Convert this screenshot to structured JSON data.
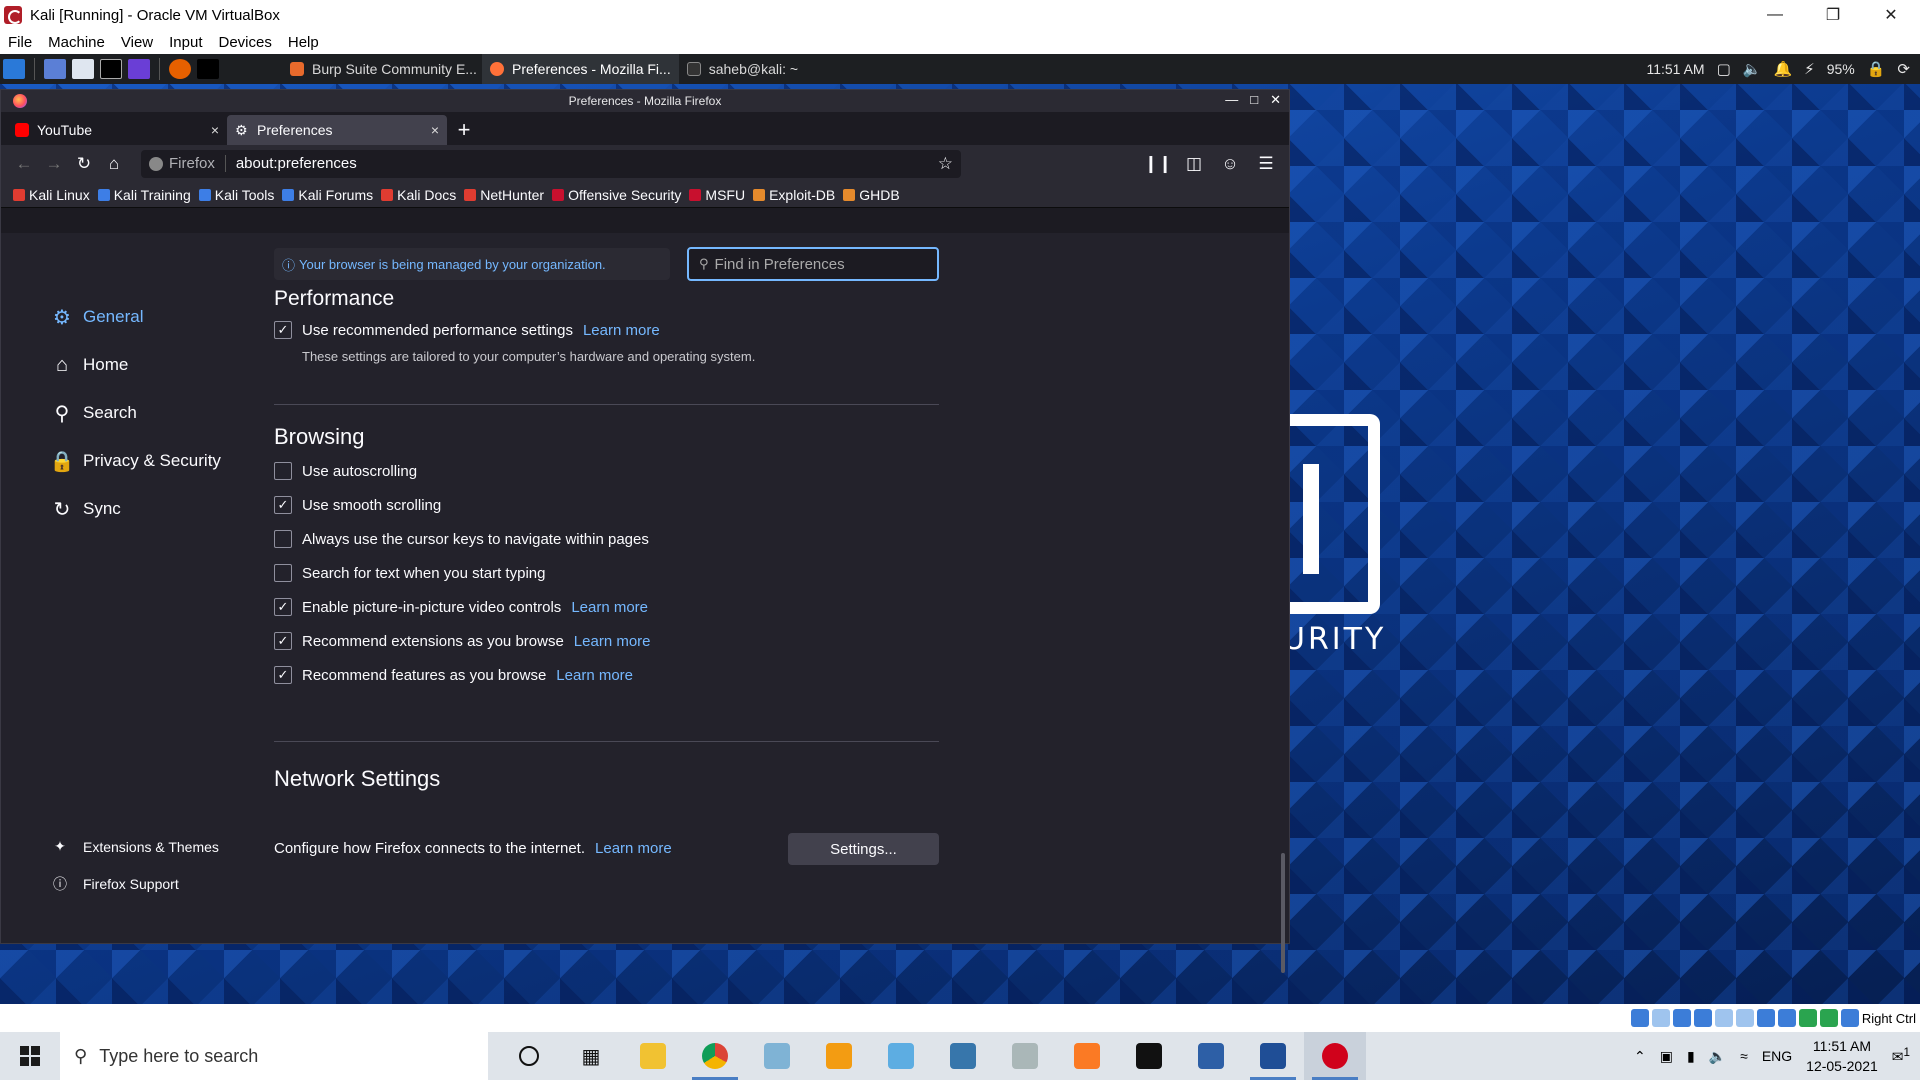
{
  "host": {
    "title": "Kali [Running] - Oracle VM VirtualBox",
    "menu": [
      "File",
      "Machine",
      "View",
      "Input",
      "Devices",
      "Help"
    ],
    "status_right_ctrl": "Right Ctrl"
  },
  "kali_panel": {
    "tasks": [
      "Burp Suite Community E...",
      "Preferences - Mozilla Fi...",
      "saheb@kali: ~"
    ],
    "time": "11:51 AM",
    "battery": "95%"
  },
  "wallpaper_text": "URITY",
  "firefox": {
    "window_title": "Preferences - Mozilla Firefox",
    "tabs": [
      {
        "label": "YouTube",
        "close": "×"
      },
      {
        "label": "Preferences",
        "close": "×"
      }
    ],
    "new_tab": "+",
    "url_identity": "Firefox",
    "url": "about:preferences",
    "bookmarks": [
      "Kali Linux",
      "Kali Training",
      "Kali Tools",
      "Kali Forums",
      "Kali Docs",
      "NetHunter",
      "Offensive Security",
      "MSFU",
      "Exploit-DB",
      "GHDB"
    ]
  },
  "prefs": {
    "policy_notice": "Your browser is being managed by your organization.",
    "find_placeholder": "Find in Preferences",
    "nav": [
      "General",
      "Home",
      "Search",
      "Privacy & Security",
      "Sync"
    ],
    "footer": [
      "Extensions & Themes",
      "Firefox Support"
    ],
    "performance": {
      "title": "Performance",
      "recommended": "Use recommended performance settings",
      "hint": "These settings are tailored to your computer’s hardware and operating system."
    },
    "learn_more": "Learn more",
    "browsing": {
      "title": "Browsing",
      "items": [
        {
          "label": "Use autoscrolling",
          "checked": false
        },
        {
          "label": "Use smooth scrolling",
          "checked": true
        },
        {
          "label": "Always use the cursor keys to navigate within pages",
          "checked": false
        },
        {
          "label": "Search for text when you start typing",
          "checked": false
        },
        {
          "label": "Enable picture-in-picture video controls",
          "checked": true
        },
        {
          "label": "Recommend extensions as you browse",
          "checked": true
        },
        {
          "label": "Recommend features as you browse",
          "checked": true
        }
      ]
    },
    "network": {
      "title": "Network Settings",
      "desc": "Configure how Firefox connects to the internet.",
      "button": "Settings..."
    }
  },
  "windows": {
    "search_placeholder": "Type here to search",
    "lang": "ENG",
    "time": "11:51 AM",
    "date": "12-05-2021",
    "notif_count": "1"
  }
}
